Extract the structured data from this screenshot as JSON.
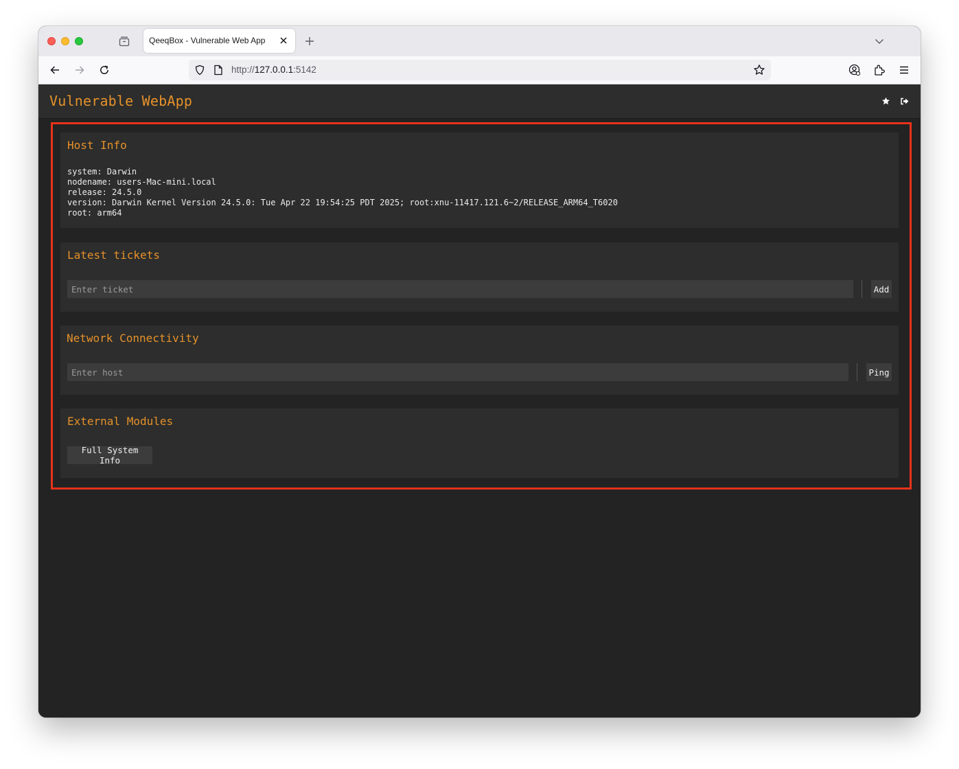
{
  "browser": {
    "tab": {
      "title": "QeeqBox - Vulnerable Web App"
    },
    "url": {
      "scheme": "http://",
      "host": "127.0.0.1",
      "port": ":5142"
    },
    "icons": {
      "back": "arrow-left-icon",
      "forward": "arrow-right-icon",
      "reload": "reload-icon",
      "shield": "shield-icon",
      "page": "page-icon",
      "bookmark": "star-outline-icon",
      "account": "account-icon",
      "extensions": "puzzle-icon",
      "menu": "hamburger-icon"
    }
  },
  "app": {
    "title": "Vulnerable WebApp",
    "header_icons": [
      "star-icon",
      "sign-out-icon"
    ],
    "accent_color": "#e6912a",
    "highlight_color": "#e8321a"
  },
  "host_info": {
    "title": "Host Info",
    "lines": [
      "system: Darwin",
      "nodename: users-Mac-mini.local",
      "release: 24.5.0",
      "version: Darwin Kernel Version 24.5.0: Tue Apr 22 19:54:25 PDT 2025; root:xnu-11417.121.6~2/RELEASE_ARM64_T6020",
      "root: arm64"
    ]
  },
  "tickets": {
    "title": "Latest tickets",
    "placeholder": "Enter ticket",
    "button": "Add"
  },
  "network": {
    "title": "Network Connectivity",
    "placeholder": "Enter host",
    "button": "Ping"
  },
  "modules": {
    "title": "External Modules",
    "button": "Full System Info"
  }
}
